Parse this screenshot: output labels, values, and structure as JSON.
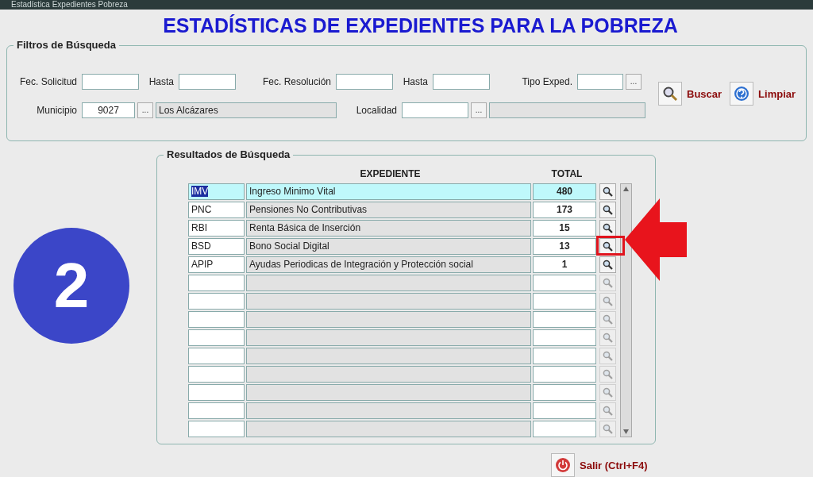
{
  "window": {
    "title": "Estadística Expedientes Pobreza"
  },
  "heading": "ESTADÍSTICAS DE EXPEDIENTES PARA LA POBREZA",
  "filters": {
    "legend": "Filtros de Búsqueda",
    "fec_solicitud": {
      "label": "Fec. Solicitud",
      "hasta_label": "Hasta"
    },
    "fec_resolucion": {
      "label": "Fec. Resolución",
      "hasta_label": "Hasta"
    },
    "tipo_exped": {
      "label": "Tipo Exped.",
      "lookup": "..."
    },
    "municipio": {
      "label": "Municipio",
      "value": "9027",
      "lookup": "...",
      "name": "Los Alcázares"
    },
    "localidad": {
      "label": "Localidad",
      "lookup": "..."
    },
    "buttons": [
      {
        "label": "Buscar",
        "kind": "search"
      },
      {
        "label": "Limpiar",
        "kind": "help"
      }
    ]
  },
  "results": {
    "legend": "Resultados de Búsqueda",
    "columns": [
      "EXPEDIENTE",
      "TOTAL"
    ],
    "rows": [
      {
        "kind": "data",
        "code": "IMV",
        "name": "Ingreso Minimo Vital",
        "total": "480",
        "selected": true,
        "marked": false
      },
      {
        "kind": "data",
        "code": "PNC",
        "name": "Pensiones No Contributivas",
        "total": "173",
        "selected": false,
        "marked": false
      },
      {
        "kind": "data",
        "code": "RBI",
        "name": "Renta Básica de Inserción",
        "total": "15",
        "selected": false,
        "marked": false
      },
      {
        "kind": "data",
        "code": "BSD",
        "name": "Bono Social Digital",
        "total": "13",
        "selected": false,
        "marked": true
      },
      {
        "kind": "data",
        "code": "APIP",
        "name": "Ayudas Periodicas de Integración y Protección social",
        "total": "1",
        "selected": false,
        "marked": false
      },
      {
        "kind": "empty"
      },
      {
        "kind": "empty"
      },
      {
        "kind": "empty"
      },
      {
        "kind": "empty"
      },
      {
        "kind": "empty"
      },
      {
        "kind": "empty"
      },
      {
        "kind": "empty"
      },
      {
        "kind": "empty"
      },
      {
        "kind": "empty"
      }
    ]
  },
  "exit_button": {
    "label": "Salir (Ctrl+F4)"
  },
  "step_badge": "2"
}
